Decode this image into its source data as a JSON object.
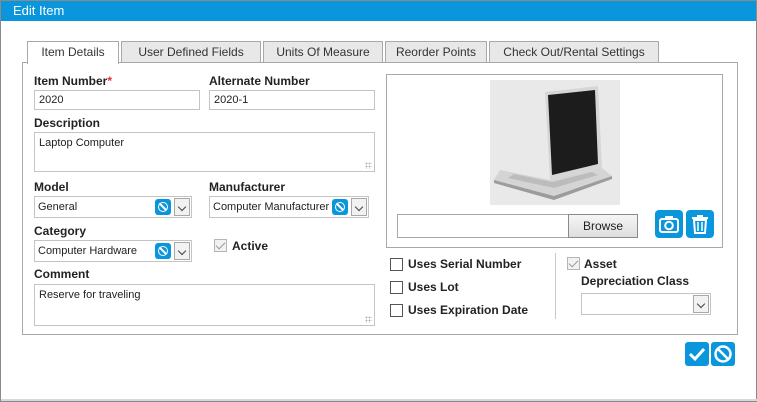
{
  "window": {
    "title": "Edit Item"
  },
  "tabs": [
    {
      "label": "Item Details"
    },
    {
      "label": "User Defined Fields"
    },
    {
      "label": "Units Of Measure"
    },
    {
      "label": "Reorder Points"
    },
    {
      "label": "Check Out/Rental Settings"
    }
  ],
  "form": {
    "item_number": {
      "label": "Item Number",
      "required_mark": "*",
      "value": "2020"
    },
    "alternate_number": {
      "label": "Alternate Number",
      "value": "2020-1"
    },
    "description": {
      "label": "Description",
      "value": "Laptop Computer"
    },
    "model": {
      "label": "Model",
      "value": "General"
    },
    "manufacturer": {
      "label": "Manufacturer",
      "value": "Computer Manufacturer"
    },
    "category": {
      "label": "Category",
      "value": "Computer Hardware"
    },
    "active": {
      "label": "Active",
      "checked": true
    },
    "comment": {
      "label": "Comment",
      "value": "Reserve for traveling"
    }
  },
  "image": {
    "browse_label": "Browse",
    "file_value": "",
    "camera_icon": "camera-icon",
    "delete_icon": "trash-icon"
  },
  "options": {
    "uses_serial_number": {
      "label": "Uses Serial Number",
      "checked": false
    },
    "uses_lot": {
      "label": "Uses Lot",
      "checked": false
    },
    "uses_expiration_date": {
      "label": "Uses Expiration Date",
      "checked": false
    },
    "asset": {
      "label": "Asset",
      "checked": true
    },
    "depreciation_class": {
      "label": "Depreciation Class",
      "value": ""
    }
  },
  "actions": {
    "ok_icon": "checkmark-icon",
    "cancel_icon": "cancel-icon"
  },
  "colors": {
    "accent": "#0a96dc",
    "required": "#e03030"
  }
}
